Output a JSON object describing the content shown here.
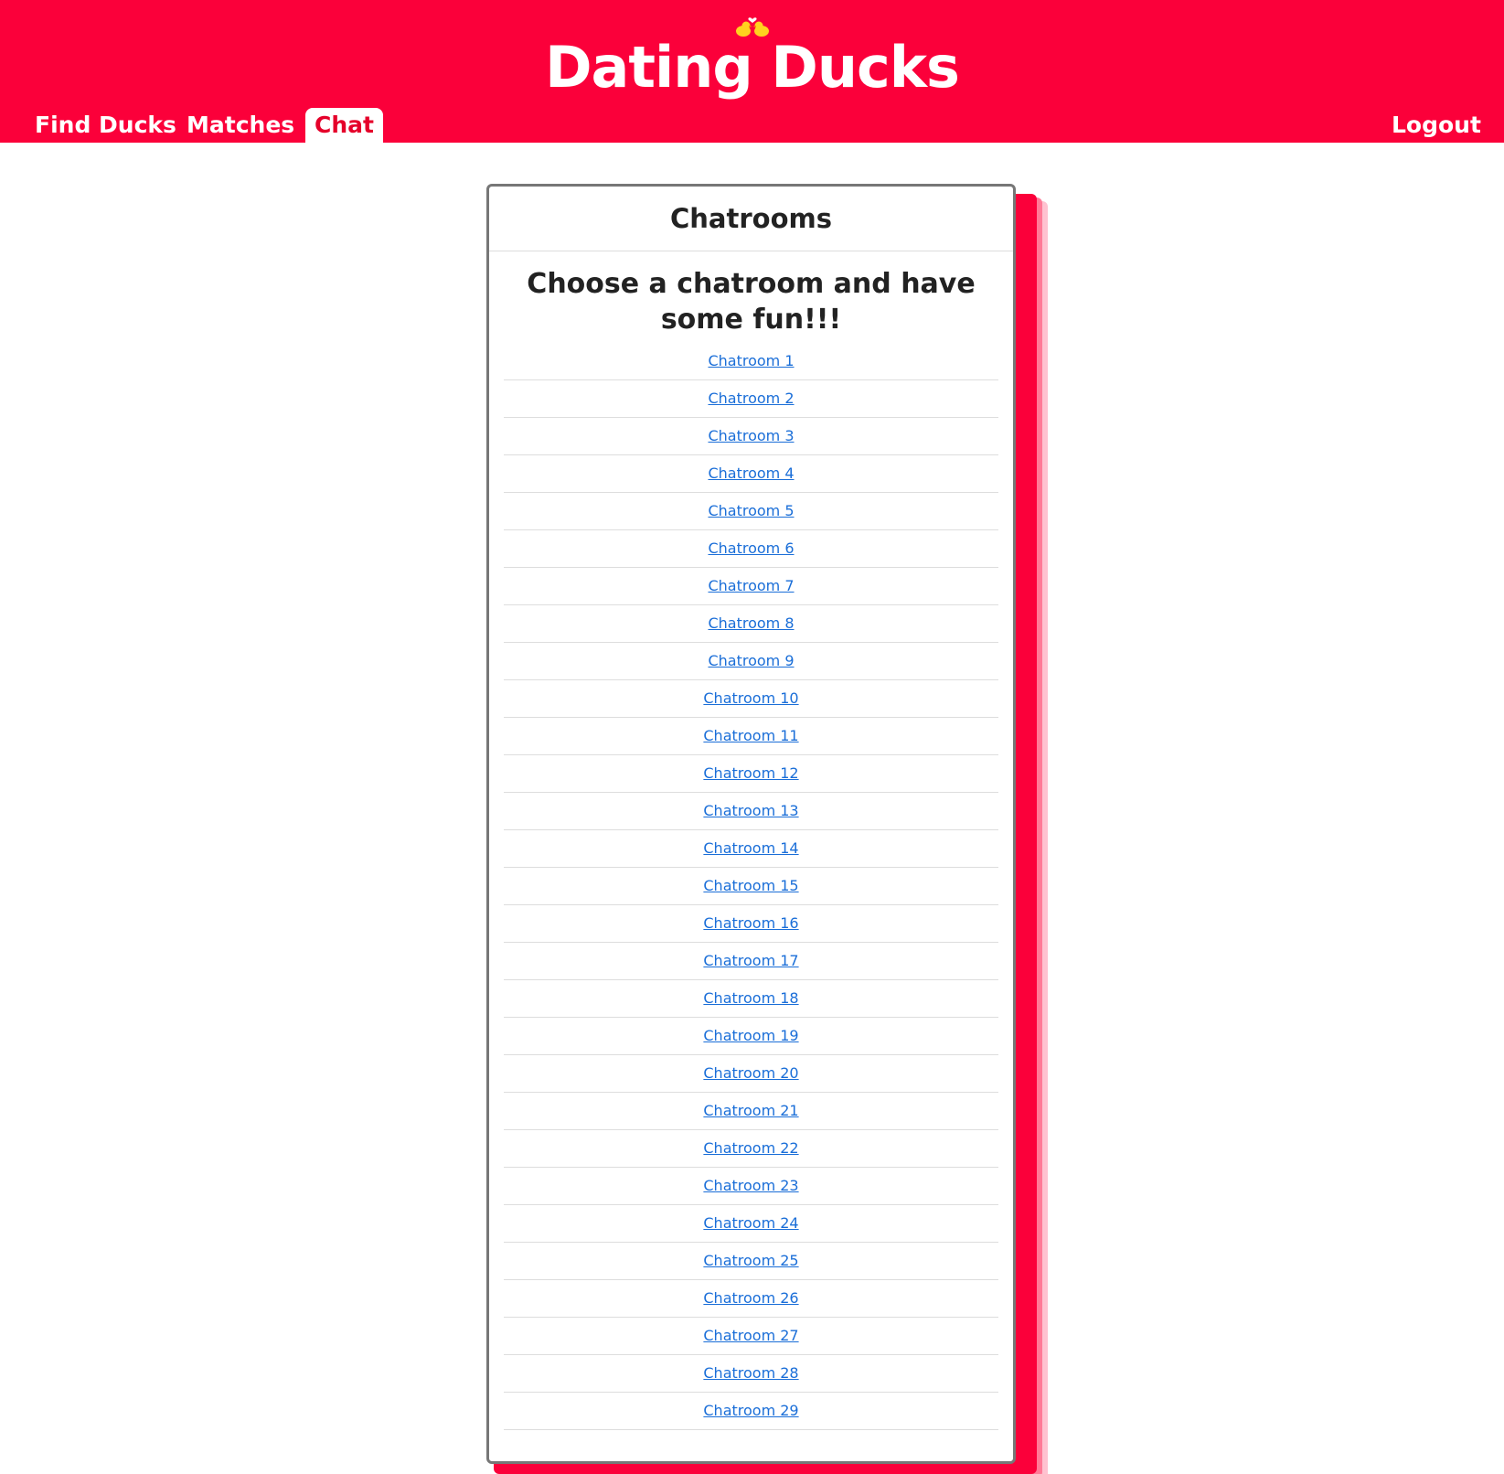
{
  "header": {
    "brand_title": "Dating Ducks",
    "logo_icon": "duck-couple-heart-icon",
    "background_color": "#fb003a"
  },
  "nav": {
    "find_ducks": "Find Ducks",
    "matches": "Matches",
    "chat": "Chat",
    "logout": "Logout",
    "active": "Chat"
  },
  "card": {
    "title": "Chatrooms",
    "subtitle": "Choose a chatroom and have some fun!!!",
    "link_color": "#1a6ed8",
    "rooms": [
      "Chatroom 1",
      "Chatroom 2",
      "Chatroom 3",
      "Chatroom 4",
      "Chatroom 5",
      "Chatroom 6",
      "Chatroom 7",
      "Chatroom 8",
      "Chatroom 9",
      "Chatroom 10",
      "Chatroom 11",
      "Chatroom 12",
      "Chatroom 13",
      "Chatroom 14",
      "Chatroom 15",
      "Chatroom 16",
      "Chatroom 17",
      "Chatroom 18",
      "Chatroom 19",
      "Chatroom 20",
      "Chatroom 21",
      "Chatroom 22",
      "Chatroom 23",
      "Chatroom 24",
      "Chatroom 25",
      "Chatroom 26",
      "Chatroom 27",
      "Chatroom 28",
      "Chatroom 29"
    ]
  }
}
